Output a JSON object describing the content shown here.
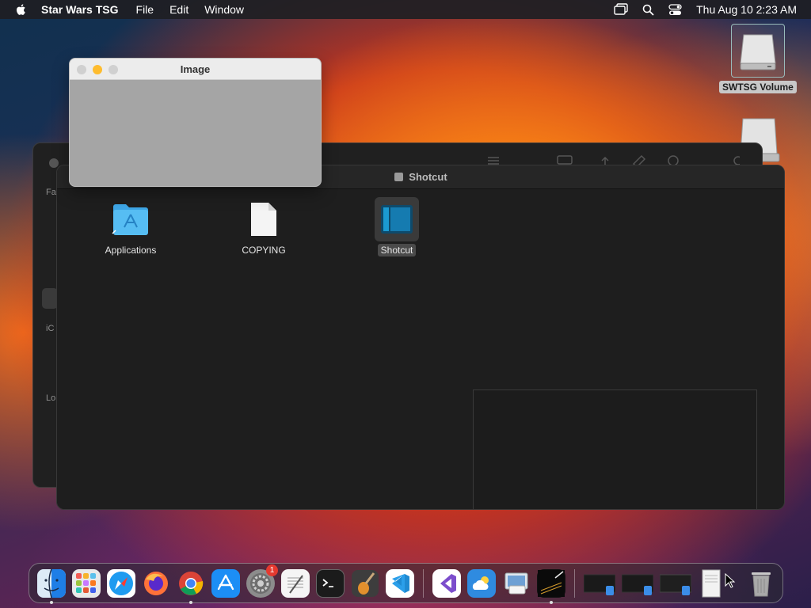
{
  "menubar": {
    "app_name": "Star Wars TSG",
    "menus": [
      "File",
      "Edit",
      "Window"
    ],
    "clock": "Thu Aug 10  2:23 AM"
  },
  "desktop": {
    "volume_label": "SWTSG Volume"
  },
  "image_window": {
    "title": "Image"
  },
  "finder_back": {
    "sidebar_partial_labels": [
      "Fa",
      "iC",
      "Lo"
    ]
  },
  "finder": {
    "title": "Shotcut",
    "items": [
      {
        "name": "Applications",
        "icon": "folder-applications-icon"
      },
      {
        "name": "COPYING",
        "icon": "document-icon"
      },
      {
        "name": "Shotcut",
        "icon": "shotcut-app-icon",
        "selected": true
      }
    ]
  },
  "dock": {
    "apps": [
      {
        "name": "Finder",
        "icon": "finder-icon",
        "running": true
      },
      {
        "name": "Launchpad",
        "icon": "launchpad-icon"
      },
      {
        "name": "Safari",
        "icon": "safari-icon"
      },
      {
        "name": "Firefox",
        "icon": "firefox-icon"
      },
      {
        "name": "Chrome",
        "icon": "chrome-icon",
        "running": true
      },
      {
        "name": "App Store",
        "icon": "app-store-icon"
      },
      {
        "name": "System Settings",
        "icon": "system-settings-icon",
        "badge": "1"
      },
      {
        "name": "TextEdit",
        "icon": "textedit-icon"
      },
      {
        "name": "Terminal",
        "icon": "terminal-icon"
      },
      {
        "name": "GarageBand",
        "icon": "garageband-icon"
      },
      {
        "name": "VS Code",
        "icon": "vscode-icon"
      },
      {
        "name": "Visual Studio",
        "icon": "visual-studio-icon"
      },
      {
        "name": "Weather",
        "icon": "weather-icon"
      },
      {
        "name": "Preview",
        "icon": "preview-icon"
      },
      {
        "name": "Star Wars TSG",
        "icon": "game-icon",
        "running": true
      }
    ],
    "minimized": [
      "window-thumb-1",
      "window-thumb-2",
      "window-thumb-3",
      "document-thumb"
    ],
    "trash": "trash-icon"
  },
  "colors": {
    "close": "#ff5f57",
    "minimize": "#febc2e",
    "inactive": "#d0d0d0",
    "folder_blue": "#4db7f0",
    "badge_red": "#e6392f"
  }
}
